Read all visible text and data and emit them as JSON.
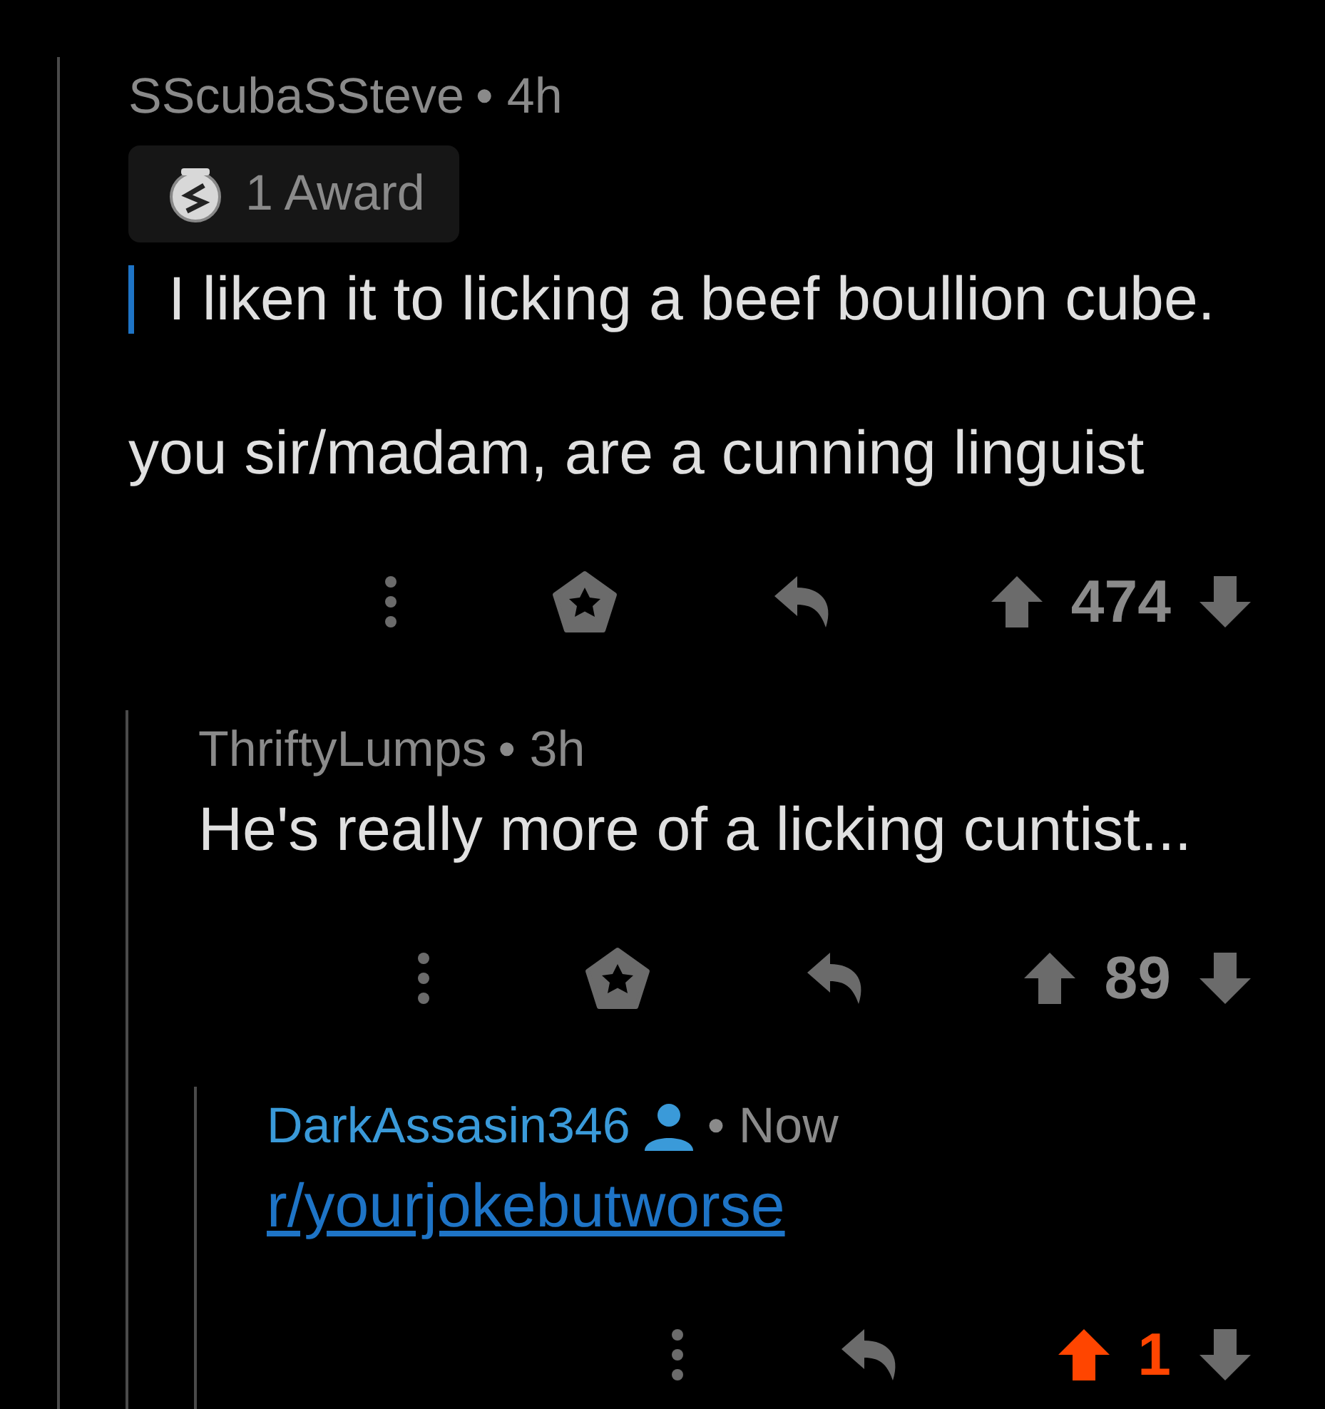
{
  "comments": [
    {
      "author": "SScubaSSteve",
      "is_self": false,
      "time": "• 4h",
      "award": "1 Award",
      "quote": "I liken it to licking a beef boullion cube.",
      "body": {
        "kind": "text",
        "text": "you sir/madam, are a cunning linguist"
      },
      "can_award": true,
      "score": "474",
      "upvoted": false,
      "children": [
        {
          "author": "ThriftyLumps",
          "is_self": false,
          "time": "• 3h",
          "body": {
            "kind": "text",
            "text": "He's really more of a licking cuntist..."
          },
          "can_award": true,
          "score": "89",
          "upvoted": false,
          "children": [
            {
              "author": "DarkAssasin346",
              "is_self": true,
              "time": "• Now",
              "body": {
                "kind": "link",
                "text": "r/yourjokebutworse"
              },
              "can_award": false,
              "score": "1",
              "upvoted": true
            }
          ]
        }
      ]
    }
  ]
}
